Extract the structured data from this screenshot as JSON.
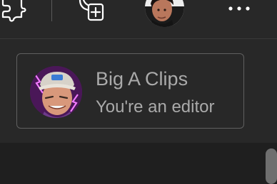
{
  "header": {
    "icons": {
      "settings": "gear-icon",
      "create": "create-icon",
      "more": "more-icon"
    },
    "account_avatar": "account-avatar"
  },
  "channel": {
    "name": "Big A Clips",
    "role": "You're an editor",
    "avatar": "channel-avatar"
  },
  "colors": {
    "header_bg": "#282828",
    "panel_bg": "#282828",
    "page_bg": "#1f1f1f",
    "text": "#aaaaaa",
    "card_border": "#606060",
    "icon": "#ffffff"
  }
}
